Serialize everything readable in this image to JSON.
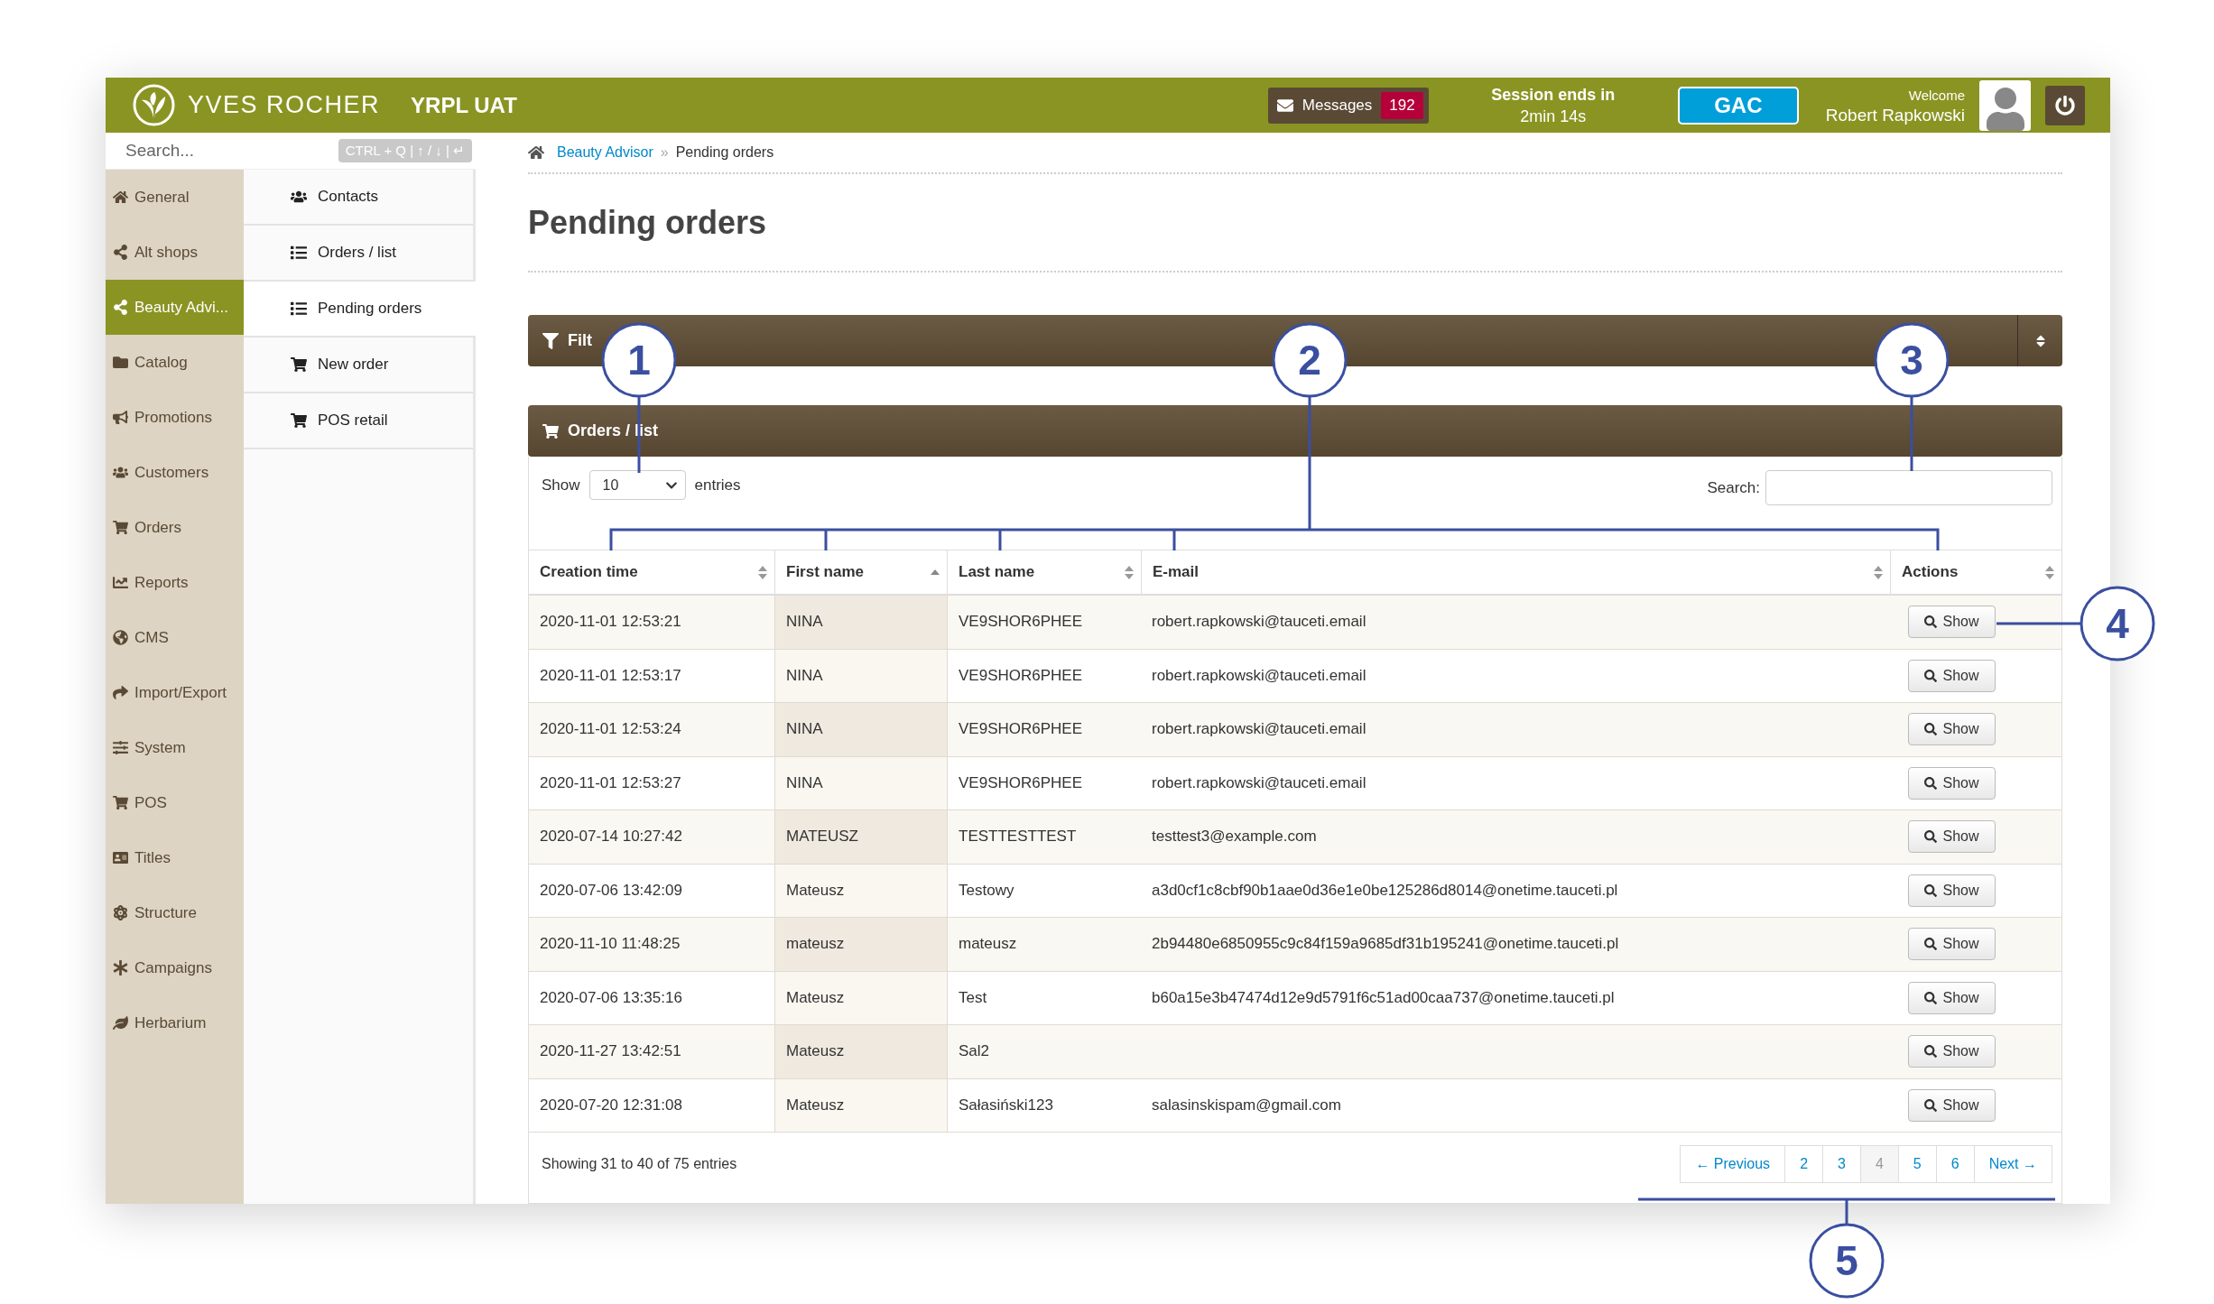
{
  "header": {
    "brand": "YVES ROCHER",
    "environment": "YRPL UAT",
    "messages": {
      "label": "Messages",
      "count": "192"
    },
    "session": {
      "title": "Session ends in",
      "remaining": "2min 14s"
    },
    "store_button": "GAC",
    "welcome": "Welcome",
    "user_name": "Robert Rapkowski"
  },
  "sidebar": {
    "search": {
      "placeholder": "Search...",
      "shortcut": "CTRL + Q | ↑ / ↓ | ↵"
    },
    "items": [
      {
        "label": "General",
        "selected": false
      },
      {
        "label": "Alt shops",
        "selected": false
      },
      {
        "label": "Beauty Advi...",
        "selected": true
      },
      {
        "label": "Catalog",
        "selected": false
      },
      {
        "label": "Promotions",
        "selected": false
      },
      {
        "label": "Customers",
        "selected": false
      },
      {
        "label": "Orders",
        "selected": false
      },
      {
        "label": "Reports",
        "selected": false
      },
      {
        "label": "CMS",
        "selected": false
      },
      {
        "label": "Import/Export",
        "selected": false
      },
      {
        "label": "System",
        "selected": false
      },
      {
        "label": "POS",
        "selected": false
      },
      {
        "label": "Titles",
        "selected": false
      },
      {
        "label": "Structure",
        "selected": false
      },
      {
        "label": "Campaigns",
        "selected": false
      },
      {
        "label": "Herbarium",
        "selected": false
      }
    ],
    "subitems": [
      {
        "label": "Contacts",
        "selected": false
      },
      {
        "label": "Orders / list",
        "selected": false
      },
      {
        "label": "Pending orders",
        "selected": true
      },
      {
        "label": "New order",
        "selected": false
      },
      {
        "label": "POS retail",
        "selected": false
      }
    ]
  },
  "breadcrumb": {
    "items": [
      {
        "label": "Beauty Advisor",
        "kind": "link"
      },
      {
        "label": "Pending orders",
        "kind": "current"
      }
    ],
    "separator": "»"
  },
  "title": "Pending orders",
  "filter_panel": {
    "title": "Filt"
  },
  "orders_panel": {
    "title": "Orders / list",
    "length_prefix": "Show",
    "length_value": "10",
    "length_suffix": "entries",
    "search_label": "Search:"
  },
  "table": {
    "columns": [
      {
        "label": "Creation time",
        "sorted": false
      },
      {
        "label": "First name",
        "sorted": true
      },
      {
        "label": "Last name",
        "sorted": false
      },
      {
        "label": "E-mail",
        "sorted": false
      },
      {
        "label": "Actions",
        "sorted": false
      }
    ],
    "rows": [
      {
        "created": "2020-11-01 12:53:21",
        "first_name": "NINA",
        "last_name": "VE9SHOR6PHEE",
        "email": "robert.rapkowski@tauceti.email",
        "action": "Show"
      },
      {
        "created": "2020-11-01 12:53:17",
        "first_name": "NINA",
        "last_name": "VE9SHOR6PHEE",
        "email": "robert.rapkowski@tauceti.email",
        "action": "Show"
      },
      {
        "created": "2020-11-01 12:53:24",
        "first_name": "NINA",
        "last_name": "VE9SHOR6PHEE",
        "email": "robert.rapkowski@tauceti.email",
        "action": "Show"
      },
      {
        "created": "2020-11-01 12:53:27",
        "first_name": "NINA",
        "last_name": "VE9SHOR6PHEE",
        "email": "robert.rapkowski@tauceti.email",
        "action": "Show"
      },
      {
        "created": "2020-07-14 10:27:42",
        "first_name": "MATEUSZ",
        "last_name": "TESTTESTTEST",
        "email": "testtest3@example.com",
        "action": "Show"
      },
      {
        "created": "2020-07-06 13:42:09",
        "first_name": "Mateusz",
        "last_name": "Testowy",
        "email": "a3d0cf1c8cbf90b1aae0d36e1e0be125286d8014@onetime.tauceti.pl",
        "action": "Show"
      },
      {
        "created": "2020-11-10 11:48:25",
        "first_name": "mateusz",
        "last_name": "mateusz",
        "email": "2b94480e6850955c9c84f159a9685df31b195241@onetime.tauceti.pl",
        "action": "Show"
      },
      {
        "created": "2020-07-06 13:35:16",
        "first_name": "Mateusz",
        "last_name": "Test",
        "email": "b60a15e3b47474d12e9d5791f6c51ad00caa737@onetime.tauceti.pl",
        "action": "Show"
      },
      {
        "created": "2020-11-27 13:42:51",
        "first_name": "Mateusz",
        "last_name": "Sal2",
        "action": "Show"
      },
      {
        "created": "2020-07-20 12:31:08",
        "first_name": "Mateusz",
        "last_name": "Sałasiński123",
        "email": "salasinskispam@gmail.com",
        "action": "Show"
      }
    ]
  },
  "footer": {
    "info": "Showing 31 to 40 of 75 entries",
    "pagination": [
      {
        "label": "← Previous",
        "selected": false
      },
      {
        "label": "2",
        "selected": false
      },
      {
        "label": "3",
        "selected": false
      },
      {
        "label": "4",
        "selected": true
      },
      {
        "label": "5",
        "selected": false
      },
      {
        "label": "6",
        "selected": false
      },
      {
        "label": "Next →",
        "selected": false
      }
    ]
  },
  "callouts": [
    "1",
    "2",
    "3",
    "4",
    "5"
  ]
}
